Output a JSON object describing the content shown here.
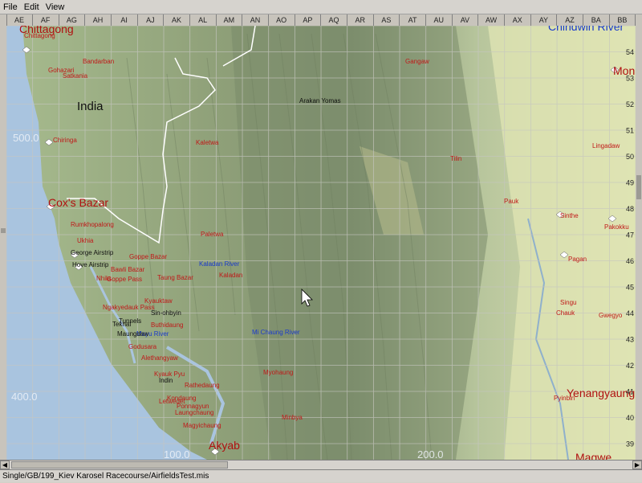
{
  "menu": [
    "File",
    "Edit",
    "View"
  ],
  "columns": [
    "AE",
    "AF",
    "AG",
    "AH",
    "AI",
    "AJ",
    "AK",
    "AL",
    "AM",
    "AN",
    "AO",
    "AP",
    "AQ",
    "AR",
    "AS",
    "AT",
    "AU",
    "AV",
    "AW",
    "AX",
    "AY",
    "AZ",
    "BA",
    "BB"
  ],
  "rows": [
    "54",
    "53",
    "52",
    "51",
    "50",
    "49",
    "48",
    "47",
    "46",
    "45",
    "44",
    "43",
    "42",
    "41",
    "40",
    "39"
  ],
  "coords": [
    "500.0",
    "400.0",
    "100.0",
    "200.0"
  ],
  "big_labels": [
    "India",
    "Chittagong",
    "Cox's Bazar",
    "Akyab",
    "Chindwin River",
    "Yenangyaung",
    "Magwe",
    "Mon"
  ],
  "towns": [
    "Chittagong",
    "Bandarban",
    "Gohazari",
    "Satkania",
    "Chiringa",
    "Rumkhopalong",
    "Ukhia",
    "Nhila",
    "Goppe Bazar",
    "Bawli Bazar",
    "Goppe Pass",
    "Taung Bazar",
    "Ngakyedauk Pass",
    "Kyauktaw",
    "Buthidaung",
    "Godusara",
    "Alethangyaw",
    "Kyauk Pyu",
    "Kondaung",
    "Rathedaung",
    "Laungchaung",
    "Ponnagyun",
    "Magyichaung",
    "Letwedet",
    "Kaletwa",
    "Paletwa",
    "Kaladan",
    "Myohaung",
    "Minbya",
    "Gangaw",
    "Tilin",
    "Pauk",
    "Lingadaw",
    "Sinthe",
    "Pakokku",
    "Pagan",
    "Singu",
    "Chauk",
    "Gwegyo",
    "Pyinbin"
  ],
  "rivers": [
    "Kaladan River",
    "Mi Chaung River",
    "Mayu River"
  ],
  "other_labels": [
    "Arakan Yomas",
    "Hove Airstrip",
    "George Airstrip",
    "Tunnels",
    "Maungdaw",
    "Teknaf",
    "Sin-ohbyin",
    "Indin"
  ],
  "status": "Single/GB/199_Kiev Karosel Racecourse/AirfieldsTest.mis",
  "colors": {
    "sea": "#a9c4df",
    "lowland": "#dce3b0",
    "mountain": "#8a9a78",
    "grid": "#c0c0c0",
    "border": "#ffffff",
    "town": "#c01818",
    "river": "#1a3acc",
    "label": "#101010"
  }
}
